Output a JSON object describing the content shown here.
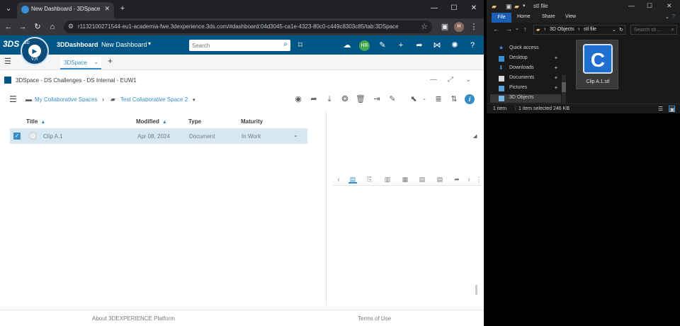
{
  "browser": {
    "tab_title": "New Dashboard - 3DSpace",
    "new_tab_icon": "+",
    "url": "r1132100271544-eu1-academia-fwe.3dexperience.3ds.com/#dashboard:04d3045-ca1e-4323-80c0-c449c8303c85/tab:3DSpace",
    "profile_initials": "H"
  },
  "dashboard": {
    "logo_text": "3DS",
    "compass_label": "V,R",
    "compass_top": "3D",
    "brand": "3DDashboard",
    "dashboard_name": "New Dashboard",
    "search_placeholder": "Search",
    "avatar_initials": "HR",
    "active_tab": "3DSpace"
  },
  "widget": {
    "title": "3DSpace - DS Challenges - DS Internal - EUW1",
    "breadcrumb": [
      "My Collaborative Spaces",
      "Test Collaborative Space 2"
    ]
  },
  "grid": {
    "columns": [
      "Title",
      "Modified",
      "Type",
      "Maturity"
    ],
    "rows": [
      {
        "title": "Clip A.1",
        "modified": "Apr 08, 2024",
        "type": "Document",
        "maturity": "In Work"
      }
    ]
  },
  "footer": {
    "about": "About 3DEXPERIENCE Platform",
    "terms": "Terms of Use"
  },
  "explorer": {
    "title": "stl file",
    "ribbon_tabs": [
      "File",
      "Home",
      "Share",
      "View"
    ],
    "path": [
      "3D Objects",
      "stl file"
    ],
    "search_placeholder": "Search stl ...",
    "nav_items": [
      {
        "label": "Quick access"
      },
      {
        "label": "Desktop"
      },
      {
        "label": "Downloads"
      },
      {
        "label": "Documents"
      },
      {
        "label": "Pictures"
      },
      {
        "label": "3D Objects"
      }
    ],
    "file_name": "Clip A.1.stl",
    "status_items": "1 item",
    "status_selected": "1 item selected  246 KB"
  },
  "colors": {
    "brand_blue": "#005686",
    "accent_blue": "#368ec4",
    "selected_row": "#d5e8f2",
    "avatar_green": "#46a84d"
  }
}
